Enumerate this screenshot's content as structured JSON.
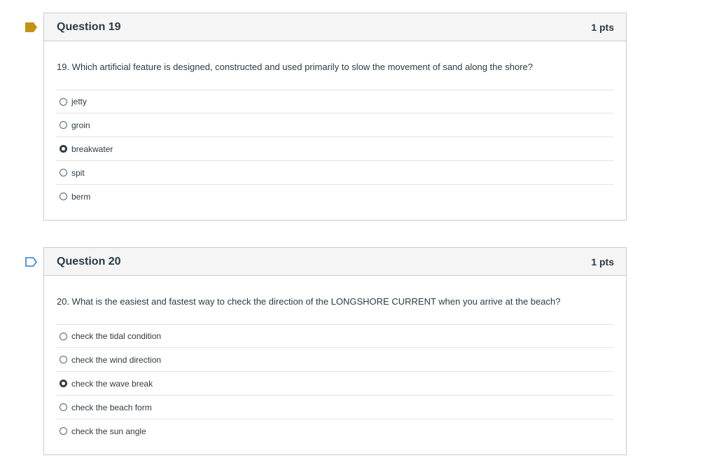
{
  "questions": [
    {
      "title": "Question 19",
      "points": "1 pts",
      "flagged": true,
      "text": "19.  Which artificial feature is designed, constructed  and used primarily to slow  the movement of sand along the shore?",
      "answers": [
        "jetty",
        "groin",
        "breakwater",
        "spit",
        "berm"
      ],
      "selected": "breakwater"
    },
    {
      "title": "Question 20",
      "points": "1 pts",
      "flagged": false,
      "text": "20.  What is the easiest and fastest way to check the direction of the  LONGSHORE CURRENT  when you arrive at the beach?",
      "answers": [
        "check the tidal condition",
        "check the wind direction",
        "check the wave break",
        "check the beach form",
        "check the sun angle"
      ],
      "selected": "check the wave break"
    }
  ],
  "colors": {
    "flag_filled": "#c39413",
    "flag_outline": "#2d7fd3",
    "header_bg": "#f5f5f5",
    "border": "#c7cdd1"
  }
}
